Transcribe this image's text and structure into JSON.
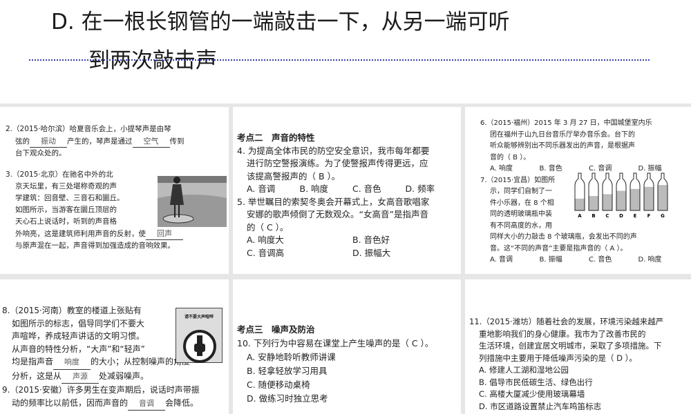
{
  "slide": {
    "line1": "D. 在一根长钢管的一端敲击一下，从另一端可听",
    "line2": "到两次敲击声"
  },
  "q2": {
    "prefix": "2.（2015·哈尔滨）哈夏音乐会上，小提琴声是由琴",
    "line2a": "弦的",
    "blank1": "振动",
    "line2b": "产生的，琴声是通过",
    "blank2": "空气",
    "line2c": "传到",
    "line3": "台下观众处的。"
  },
  "q3": {
    "lines": [
      "3.（2015·北京）在驰名中外的北",
      "京天坛里，有三处堪称奇观的声",
      "学建筑：回音壁、三音石和圜丘。",
      "如图所示，当游客在圜丘顶层的",
      "天心石上说话时，听到的声音格"
    ],
    "line6a": "外响亮，这是建筑师利用声音的反射，使",
    "blank": "回声",
    "line7": "与原声混在一起，声音得到加强造成的音响效果。"
  },
  "section2": "考点二　声音的特性",
  "q4": {
    "lines": [
      "4. 为提高全体市民的防空安全意识，我市每年都要",
      "进行防空警报演练。为了使警报声传得更远，应",
      "该提高警报声的（ B ）。"
    ],
    "options": [
      "A. 音调",
      "B. 响度",
      "C. 音色",
      "D. 频率"
    ]
  },
  "q5": {
    "lines": [
      "5. 举世瞩目的索契冬奥会开幕式上，女高音歌唱家",
      "安娜的歌声倾倒了无数观众。“女高音”是指声音",
      "的（ C ）。"
    ],
    "options": [
      "A. 响度大",
      "B. 音色好",
      "C. 音调高",
      "D. 振幅大"
    ]
  },
  "q6": {
    "lines": [
      "6.（2015·福州）2015 年 3 月 27 日，中国城堡室内乐",
      "团在福州于山九日台音乐厅举办音乐会。台下的",
      "听众能够辨别出不同乐器发出的声音，是根据声",
      "音的（ B ）。"
    ],
    "options": [
      "A. 响度",
      "B. 音色",
      "C. 音调",
      "D. 振幅"
    ]
  },
  "q7": {
    "lines": [
      "7.（2015·宜昌）如图所",
      "示，同学们自制了一",
      "件小乐器，在 8 个相",
      "同的透明玻璃瓶中装",
      "有不同高度的水，用"
    ],
    "tail": [
      "同样大小的力敲击 8 个玻璃瓶，会发出不同的声",
      "音。这“不同的声音”主要是指声音的（ A ）。"
    ],
    "options": [
      "A. 音调",
      "B. 振幅",
      "C. 音色",
      "D. 响度"
    ],
    "bottle_labels": [
      "A",
      "B",
      "C",
      "D",
      "E",
      "F",
      "G"
    ],
    "water_levels": [
      0.45,
      0.55,
      0.62,
      0.75,
      0.82,
      0.9,
      0.97
    ]
  },
  "q8": {
    "lines": [
      "8.（2015·河南）教室的楼道上张贴有",
      "如图所示的标志，倡导同学们不要大",
      "声喧哗，养成轻声讲话的文明习惯。",
      "从声音的特性分析，“大声”和“轻声”"
    ],
    "l5a": "均是指声音",
    "blank1": "响度",
    "l5b": "的大小；从控制噪声的角度",
    "l6a": "分析，这是从",
    "blank2": "声源",
    "l6b": "处减弱噪声。",
    "sign_text": "请不要大声喧哗"
  },
  "q9": {
    "line1": "9.（2015·安徽）许多男生在变声期后，说话时声带振",
    "l2a": "动的频率比以前低，因而声音的",
    "blank": "音调",
    "l2b": "会降低。"
  },
  "section3": "考点三　噪声及防治",
  "q10": {
    "stem": "10. 下列行为中容易在课堂上产生噪声的是（ C ）。",
    "options": [
      "A. 安静地聆听教师讲课",
      "B. 轻拿轻放学习用具",
      "C. 随便移动桌椅",
      "D. 做练习时独立思考"
    ]
  },
  "q11": {
    "lines": [
      "11.（2015·潍坊）随着社会的发展，环境污染越来越严",
      "重地影响我们的身心健康。我市为了改善市民的",
      "生活环境，创建宜居文明城市，采取了多项措施。下",
      "列措施中主要用于降低噪声污染的是（ D ）。"
    ],
    "options": [
      "A. 修建人工湖和湿地公园",
      "B. 倡导市民低碳生活、绿色出行",
      "C. 高楼大厦减少使用玻璃幕墙",
      "D. 市区道路设置禁止汽车鸣笛标志"
    ]
  }
}
